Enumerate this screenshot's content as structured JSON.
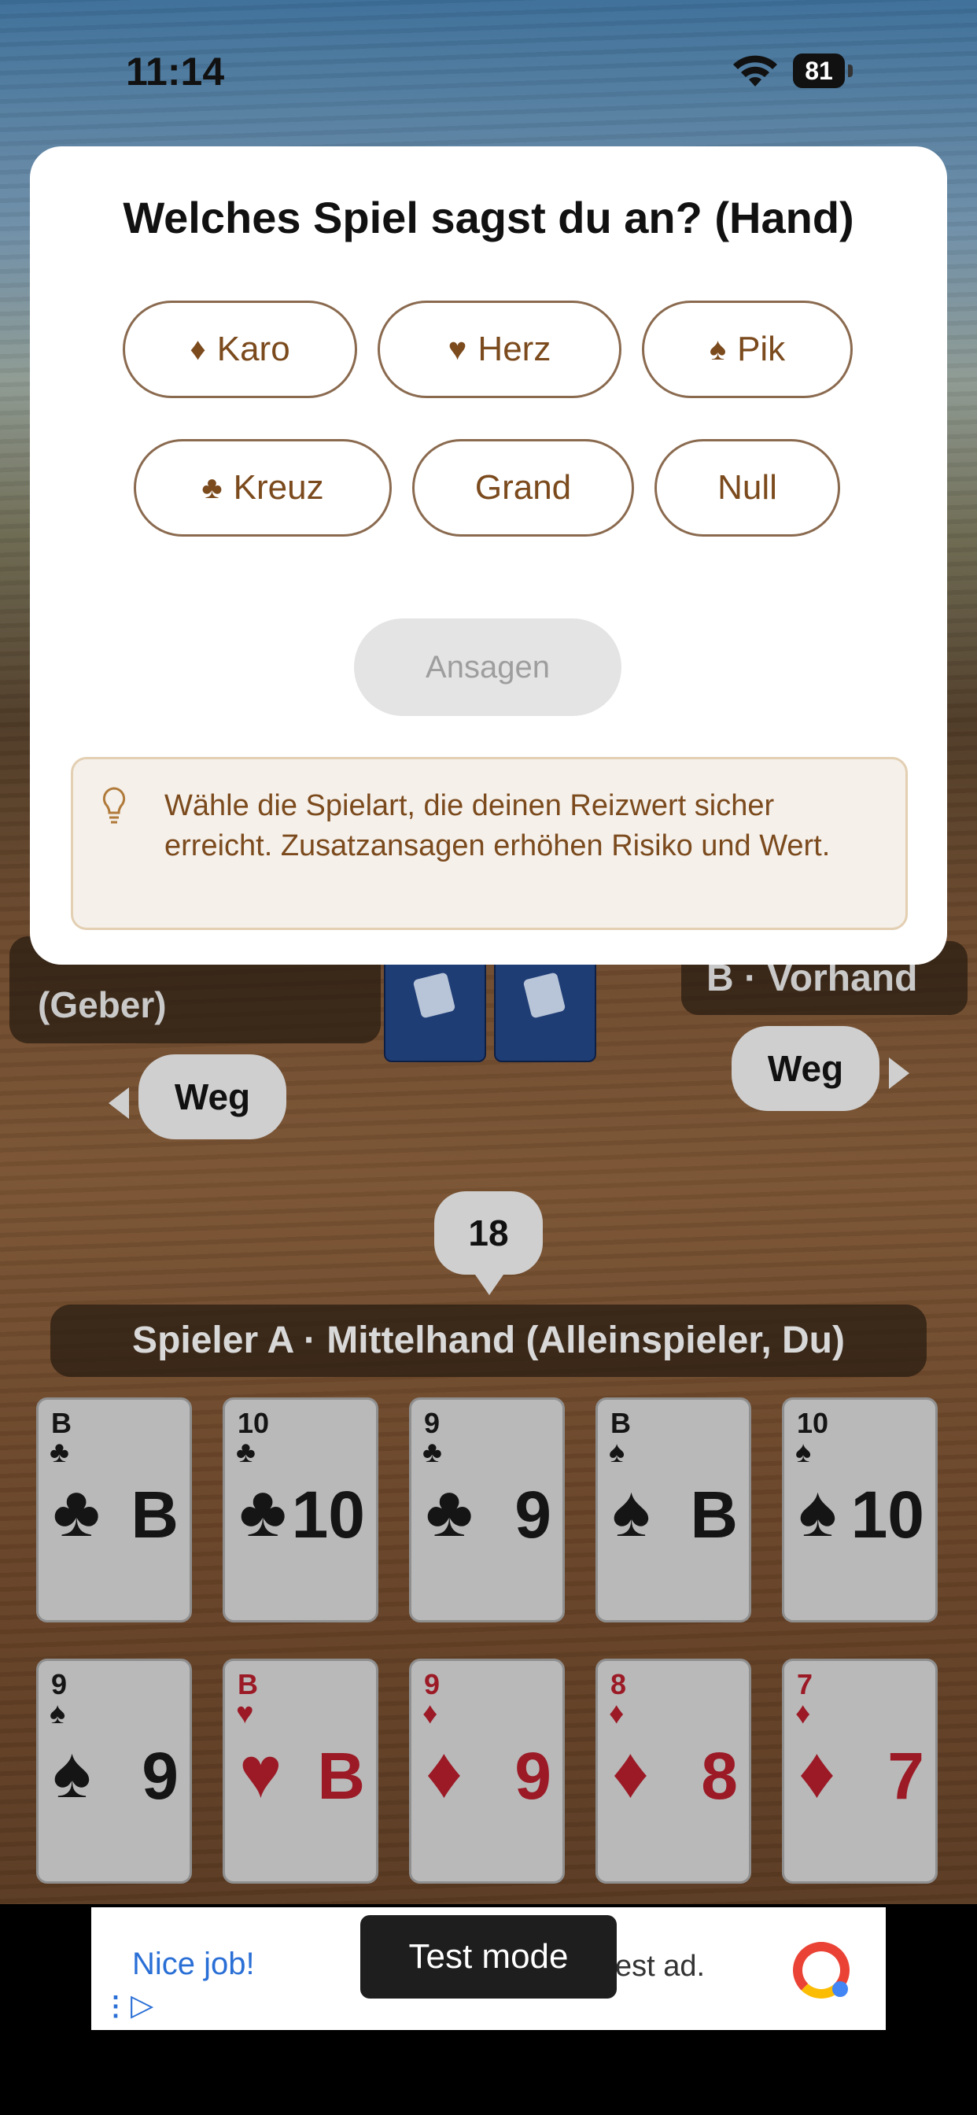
{
  "status_bar": {
    "time": "11:14",
    "battery": "81"
  },
  "dialog": {
    "title": "Welches Spiel sagst du an? (Hand)",
    "options": [
      {
        "label": "Karo",
        "symbol": "♦"
      },
      {
        "label": "Herz",
        "symbol": "♥"
      },
      {
        "label": "Pik",
        "symbol": "♠"
      },
      {
        "label": "Kreuz",
        "symbol": "♣"
      },
      {
        "label": "Grand",
        "symbol": ""
      },
      {
        "label": "Null",
        "symbol": ""
      }
    ],
    "confirm_label": "Ansagen",
    "hint": "Wähle die Spielart, die deinen Reizwert sicher erreicht. Zusatzansagen erhöhen Risiko und Wert."
  },
  "table": {
    "left_player_label": "(Geber)",
    "right_player_label": "B · Vorhand",
    "left_bubble": "Weg",
    "right_bubble": "Weg",
    "bid_value": "18",
    "player_label": "Spieler A · Mittelhand (Alleinspieler, Du)"
  },
  "hand": [
    {
      "rank": "B",
      "suit": "♣",
      "color": "black"
    },
    {
      "rank": "10",
      "suit": "♣",
      "color": "black"
    },
    {
      "rank": "9",
      "suit": "♣",
      "color": "black"
    },
    {
      "rank": "B",
      "suit": "♠",
      "color": "black"
    },
    {
      "rank": "10",
      "suit": "♠",
      "color": "black"
    },
    {
      "rank": "9",
      "suit": "♠",
      "color": "black"
    },
    {
      "rank": "B",
      "suit": "♥",
      "color": "red"
    },
    {
      "rank": "9",
      "suit": "♦",
      "color": "red"
    },
    {
      "rank": "8",
      "suit": "♦",
      "color": "red"
    },
    {
      "rank": "7",
      "suit": "♦",
      "color": "red"
    }
  ],
  "ad": {
    "title": "Nice job!",
    "text": "est ad.",
    "toast": "Test mode"
  }
}
